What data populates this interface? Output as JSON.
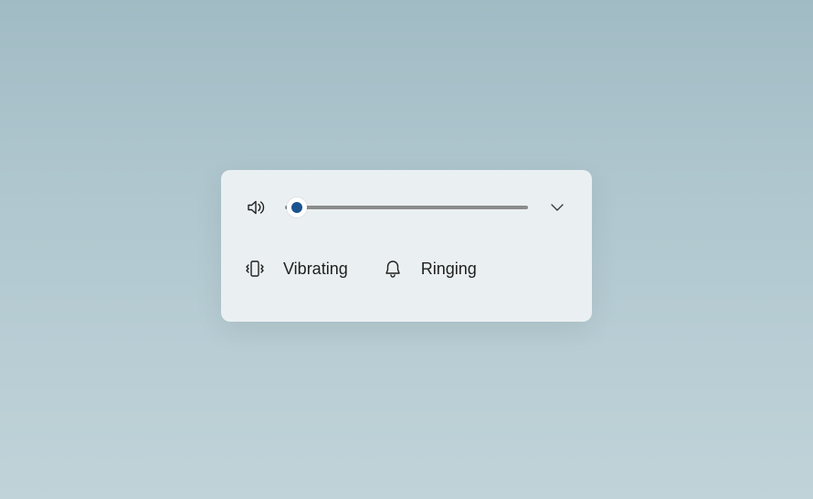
{
  "volume": {
    "level_percent": 5
  },
  "options": {
    "vibrating": {
      "label": "Vibrating"
    },
    "ringing": {
      "label": "Ringing"
    }
  }
}
